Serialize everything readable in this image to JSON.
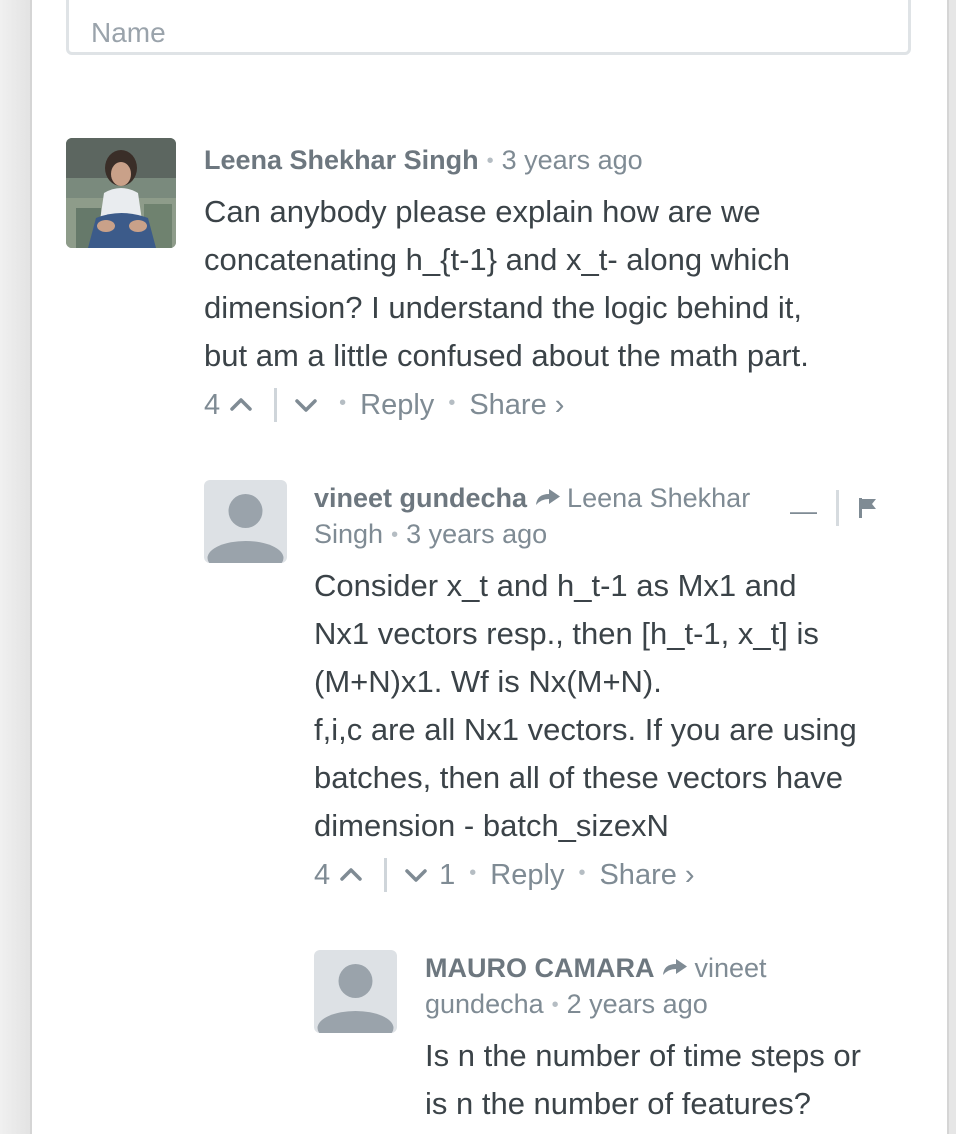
{
  "form": {
    "name_placeholder": "Name"
  },
  "comments": [
    {
      "author": "Leena Shekhar Singh",
      "time": "3 years ago",
      "body": [
        "Can anybody please explain how are we",
        "concatenating h_{t-1} and x_t- along which",
        "dimension? I understand the logic behind it,",
        "but am a little confused about the math part."
      ],
      "upvotes": "4",
      "reply_label": "Reply",
      "share_label": "Share ›"
    },
    {
      "author": "vineet gundecha",
      "reply_to_line1": "Leena Shekhar",
      "reply_to_line2": "Singh",
      "collapse_label": "—",
      "time": "3 years ago",
      "body": [
        "Consider x_t and h_t-1 as Mx1 and",
        "Nx1 vectors resp., then [h_t-1, x_t] is",
        "(M+N)x1. Wf is Nx(M+N).",
        "f,i,c are all Nx1 vectors. If you are using",
        "batches, then all of these vectors have",
        "dimension - batch_sizexN"
      ],
      "upvotes": "4",
      "downvotes": "1",
      "reply_label": "Reply",
      "share_label": "Share ›"
    },
    {
      "author": "MAURO CAMARA",
      "reply_to_line1": "vineet",
      "reply_to_line2": "gundecha",
      "time": "2 years ago",
      "body": [
        "Is n the number of time steps or",
        "is n the number of features?"
      ]
    }
  ]
}
